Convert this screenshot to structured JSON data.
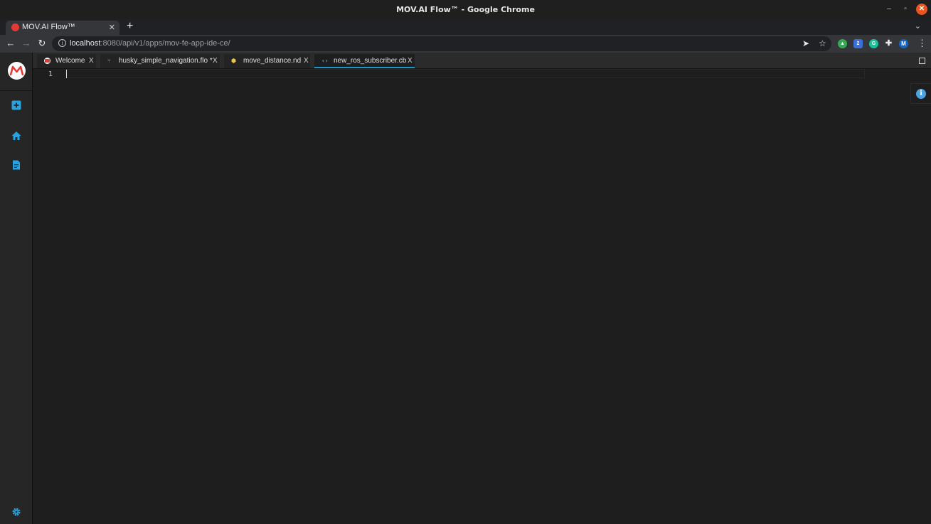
{
  "window": {
    "title": "MOV.AI Flow™ - Google Chrome",
    "minimize_glyph": "–",
    "restore_glyph": "▫",
    "close_glyph": "✕"
  },
  "browser": {
    "tab_title": "MOV.AI Flow™",
    "tab_close": "✕",
    "new_tab": "+",
    "tab_dropdown": "⌄",
    "url_host": "localhost",
    "url_rest": ":8080/api/v1/apps/mov-fe-app-ide-ce/",
    "back": "←",
    "forward": "→",
    "reload": "↻",
    "send_glyph": "➤",
    "star_glyph": "☆",
    "menu_glyph": "⋮",
    "extensions": [
      {
        "name": "green-extension-icon",
        "glyph": "▲",
        "color": "#34a853"
      },
      {
        "name": "shield-extension-icon",
        "glyph": "2",
        "color": "#3b6fd8"
      },
      {
        "name": "grammarly-extension-icon",
        "glyph": "G",
        "color": "#15c39a"
      },
      {
        "name": "puzzle-extension-icon",
        "glyph": "✚",
        "color": "#35363a"
      },
      {
        "name": "profile-avatar",
        "glyph": "M",
        "color": "#1565c0"
      }
    ]
  },
  "colors": {
    "accent": "#2196c8",
    "brand_red": "#e53935",
    "sidebar_icon": "#29a3df"
  },
  "sidebar": {
    "items": [
      {
        "name": "add-icon"
      },
      {
        "name": "home-icon"
      },
      {
        "name": "document-icon"
      }
    ],
    "settings": {
      "name": "gear-icon"
    }
  },
  "editor_tabs": [
    {
      "label": "Welcome",
      "close": "X",
      "icon": "movai-logo"
    },
    {
      "label": "husky_simple_navigation.flo *",
      "close": "X",
      "icon": "flow-icon"
    },
    {
      "label": "move_distance.nd",
      "close": "X",
      "icon": "node-icon"
    },
    {
      "label": "new_ros_subscriber.cb",
      "close": "X",
      "icon": "code-icon",
      "active": true
    }
  ],
  "editor": {
    "line_numbers": [
      "1"
    ],
    "content": ""
  },
  "info_button": {
    "glyph": "i"
  }
}
